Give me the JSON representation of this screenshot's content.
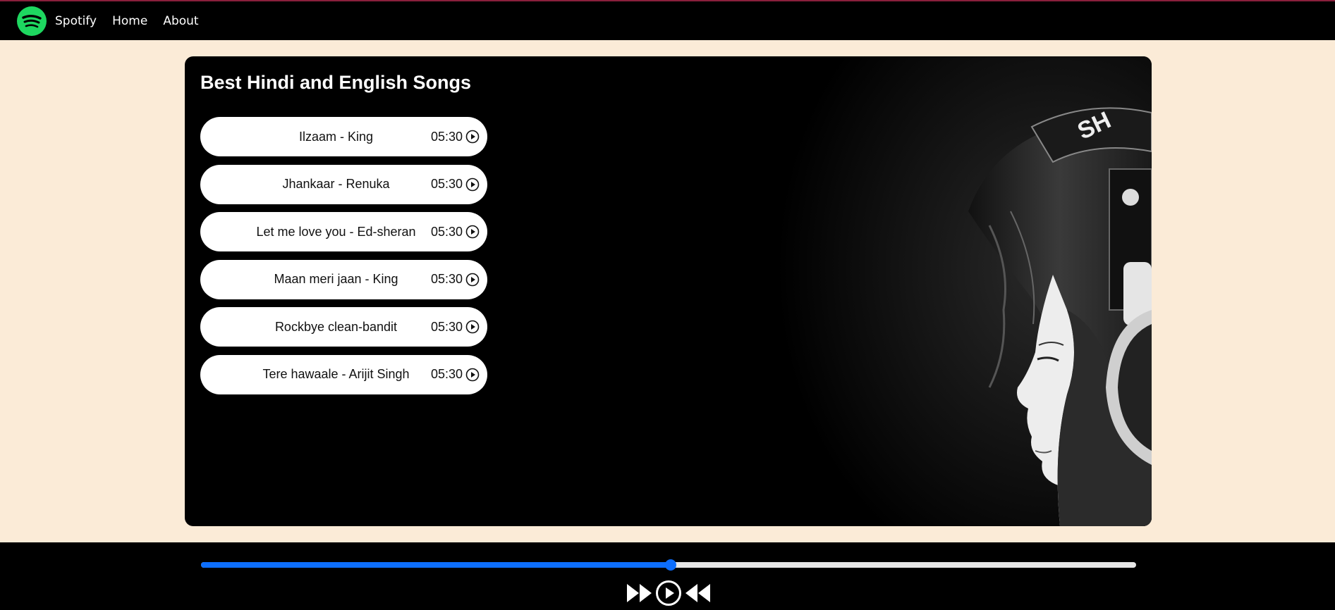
{
  "navbar": {
    "brand": "Spotify",
    "links": [
      "Home",
      "About"
    ],
    "logo_icon": "spotify-logo-icon",
    "logo_color": "#1ed760"
  },
  "main": {
    "title": "Best Hindi and English Songs",
    "hero_image": "woman-with-headphones",
    "songs": [
      {
        "name": "Ilzaam - King",
        "duration": "05:30"
      },
      {
        "name": "Jhankaar - Renuka",
        "duration": "05:30"
      },
      {
        "name": "Let me love you - Ed-sheran",
        "duration": "05:30"
      },
      {
        "name": "Maan meri jaan - King",
        "duration": "05:30"
      },
      {
        "name": "Rockbye clean-bandit",
        "duration": "05:30"
      },
      {
        "name": "Tere hawaale - Arijit Singh",
        "duration": "05:30"
      }
    ]
  },
  "player": {
    "progress_percent": 50.2,
    "accent_color": "#0d6efd",
    "controls": [
      "forward-icon",
      "play-icon",
      "backward-icon"
    ]
  }
}
